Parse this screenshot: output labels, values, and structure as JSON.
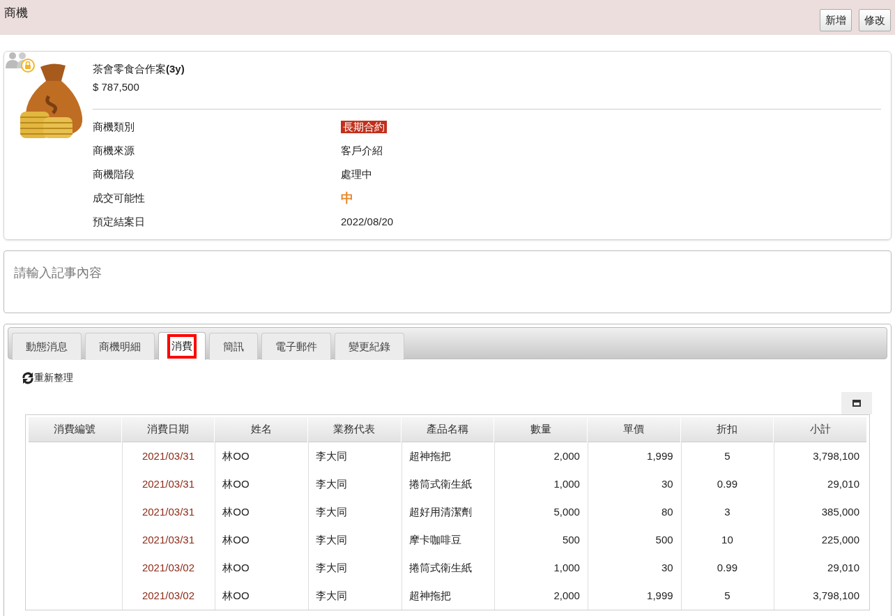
{
  "page_title": "商機",
  "header_buttons": [
    "新增",
    "修改"
  ],
  "opportunity": {
    "name": "茶會零食合作案",
    "name_suffix": "(3y)",
    "amount": "$ 787,500",
    "fields": [
      {
        "label": "商機類別",
        "value": "長期合約",
        "kind": "tag"
      },
      {
        "label": "商機來源",
        "value": "客戶介紹",
        "kind": "text"
      },
      {
        "label": "商機階段",
        "value": "處理中",
        "kind": "text"
      },
      {
        "label": "成交可能性",
        "value": "中",
        "kind": "level"
      },
      {
        "label": "預定結案日",
        "value": "2022/08/20",
        "kind": "text"
      }
    ]
  },
  "note": {
    "placeholder": "請輸入記事內容"
  },
  "tabs": [
    {
      "label": "動態消息",
      "selected": false
    },
    {
      "label": "商機明細",
      "selected": false
    },
    {
      "label": "消費",
      "selected": true
    },
    {
      "label": "簡訊",
      "selected": false
    },
    {
      "label": "電子郵件",
      "selected": false
    },
    {
      "label": "變更紀錄",
      "selected": false
    }
  ],
  "refresh_label": "重新整理",
  "table": {
    "columns": [
      "消費編號",
      "消費日期",
      "姓名",
      "業務代表",
      "產品名稱",
      "數量",
      "單價",
      "折扣",
      "小計"
    ],
    "rows": [
      [
        "",
        "2021/03/31",
        "林OO",
        "李大同",
        "超神拖把",
        "2,000",
        "1,999",
        "5",
        "3,798,100"
      ],
      [
        "",
        "2021/03/31",
        "林OO",
        "李大同",
        "捲筒式衛生紙",
        "1,000",
        "30",
        "0.99",
        "29,010"
      ],
      [
        "",
        "2021/03/31",
        "林OO",
        "李大同",
        "超好用清潔劑",
        "5,000",
        "80",
        "3",
        "385,000"
      ],
      [
        "",
        "2021/03/31",
        "林OO",
        "李大同",
        "摩卡咖啡豆",
        "500",
        "500",
        "10",
        "225,000"
      ],
      [
        "",
        "2021/03/02",
        "林OO",
        "李大同",
        "捲筒式衛生紙",
        "1,000",
        "30",
        "0.99",
        "29,010"
      ],
      [
        "",
        "2021/03/02",
        "林OO",
        "李大同",
        "超神拖把",
        "2,000",
        "1,999",
        "5",
        "3,798,100"
      ]
    ]
  }
}
